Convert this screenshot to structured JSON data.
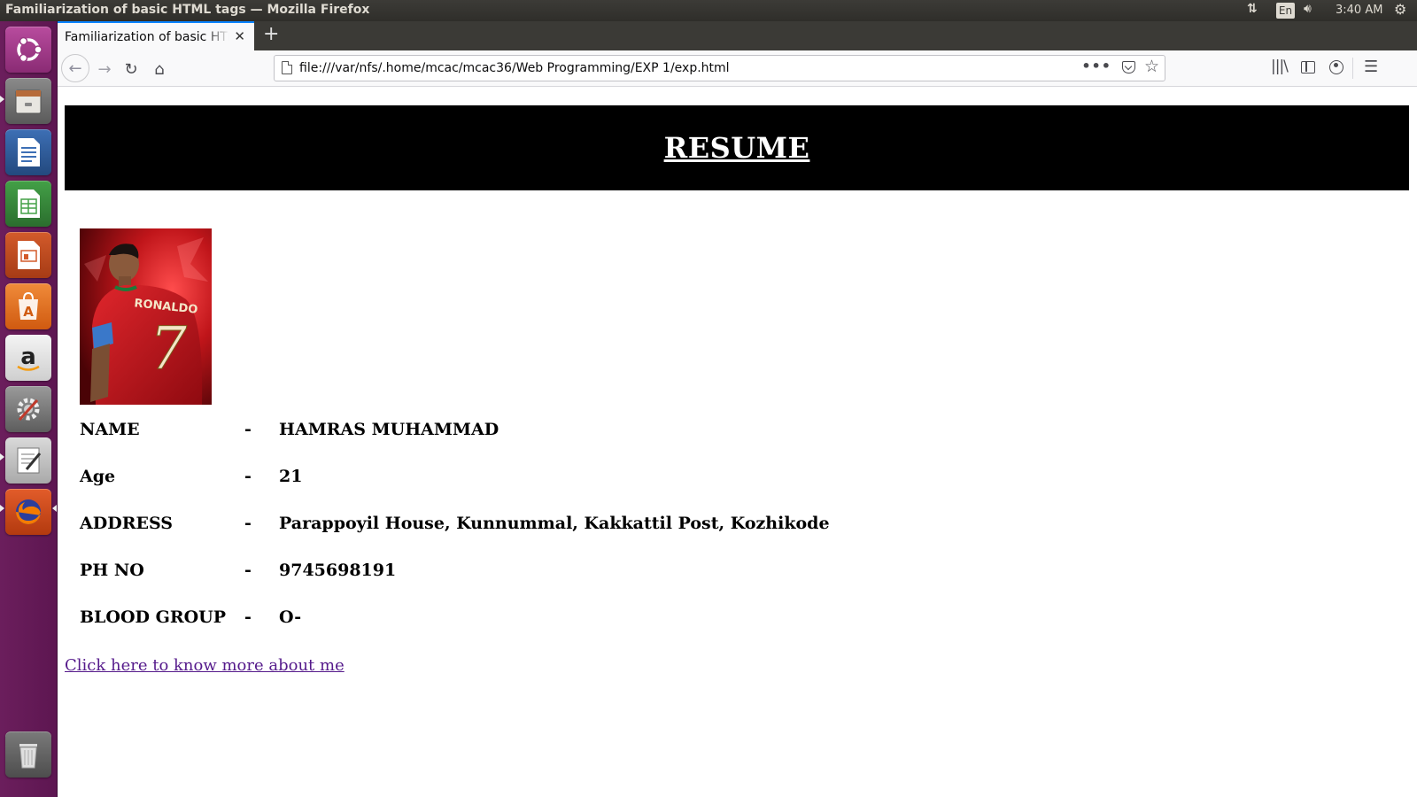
{
  "system": {
    "window_title": "Familiarization of basic HTML tags — Mozilla Firefox",
    "language_indicator": "En",
    "clock": "3:40 AM"
  },
  "launcher": {
    "items": [
      "ubuntu-dash",
      "files",
      "libreoffice-writer",
      "libreoffice-calc",
      "libreoffice-impress",
      "ubuntu-software",
      "amazon",
      "system-settings",
      "text-editor",
      "firefox",
      "trash"
    ]
  },
  "browser": {
    "tab_title": "Familiarization of basic HTML tags",
    "url": "file:///var/nfs/.home/mcac/mcac36/Web Programming/EXP 1/exp.html"
  },
  "page": {
    "header_title": "RESUME",
    "photo": {
      "jersey_name": "RONALDO",
      "jersey_number": "7"
    },
    "details": [
      {
        "label": "NAME",
        "separator": "-",
        "value": "HAMRAS MUHAMMAD"
      },
      {
        "label": "Age",
        "separator": "-",
        "value": "21"
      },
      {
        "label": "ADDRESS",
        "separator": "-",
        "value": "Parappoyil House, Kunnummal, Kakkattil Post, Kozhikode"
      },
      {
        "label": "PH NO",
        "separator": "-",
        "value": "9745698191"
      },
      {
        "label": "BLOOD GROUP",
        "separator": "-",
        "value": "O-"
      }
    ],
    "link_text": "Click here to know more about me"
  }
}
